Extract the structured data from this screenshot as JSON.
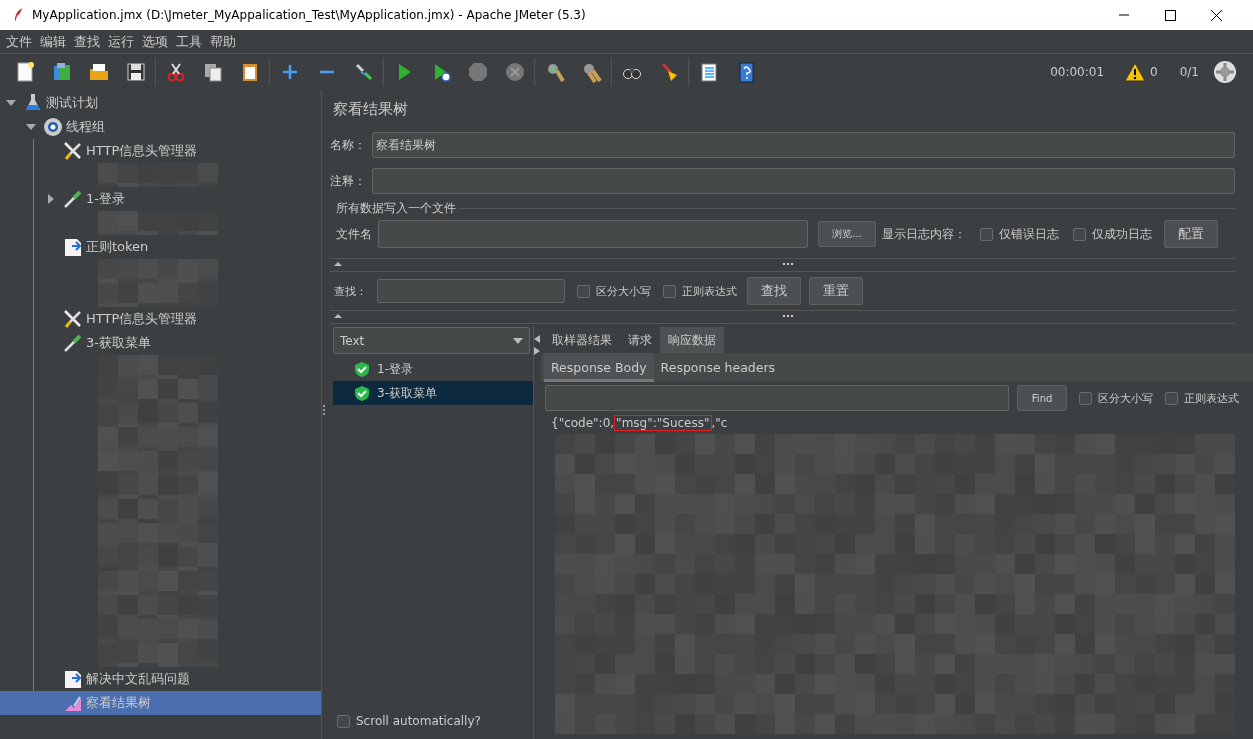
{
  "window": {
    "title": "MyApplication.jmx (D:\\Jmeter_MyAppalication_Test\\MyApplication.jmx) - Apache JMeter (5.3)"
  },
  "menu": [
    "文件",
    "编辑",
    "查找",
    "运行",
    "选项",
    "工具",
    "帮助"
  ],
  "toolbar": {
    "timer": "00:00:01",
    "warnings": "0",
    "threads": "0/1"
  },
  "tree": [
    {
      "label": "测试计划",
      "kind": "plan",
      "expanded": true,
      "selected": false,
      "children": [
        {
          "label": "线程组",
          "kind": "thread-group",
          "expanded": true,
          "selected": false,
          "children": [
            {
              "label": "HTTP信息头管理器",
              "kind": "config",
              "selected": false
            },
            {
              "kind": "blurred"
            },
            {
              "label": "1-登录",
              "kind": "sampler",
              "expanded": false,
              "selected": false
            },
            {
              "kind": "blurred"
            },
            {
              "label": "正则token",
              "kind": "processor",
              "selected": false
            },
            {
              "kind": "blurred"
            },
            {
              "kind": "blurred"
            },
            {
              "label": "HTTP信息头管理器",
              "kind": "config",
              "selected": false
            },
            {
              "label": "3-获取菜单",
              "kind": "sampler",
              "selected": false
            },
            {
              "kind": "blurred"
            },
            {
              "kind": "blurred"
            },
            {
              "kind": "blurred"
            },
            {
              "kind": "blurred"
            },
            {
              "kind": "blurred"
            },
            {
              "kind": "blurred"
            },
            {
              "kind": "blurred"
            },
            {
              "kind": "blurred"
            },
            {
              "kind": "blurred"
            },
            {
              "kind": "blurred"
            },
            {
              "kind": "blurred"
            },
            {
              "kind": "blurred"
            },
            {
              "kind": "blurred"
            },
            {
              "label": "解决中文乱码问题",
              "kind": "processor",
              "selected": false
            },
            {
              "label": "察看结果树",
              "kind": "listener",
              "selected": true
            }
          ]
        }
      ]
    }
  ],
  "panel": {
    "title": "察看结果树",
    "name_label": "名称：",
    "name_value": "察看结果树",
    "comment_label": "注释：",
    "file_group": "所有数据写入一个文件",
    "file_label": "文件名",
    "browse": "浏览...",
    "log_label": "显示日志内容：",
    "log_options": [
      {
        "label": "仅错误日志",
        "checked": false
      },
      {
        "label": "仅成功日志",
        "checked": false
      }
    ],
    "config": "配置",
    "search": {
      "label": "查找：",
      "options": [
        {
          "label": "区分大小写",
          "checked": false
        },
        {
          "label": "正则表达式",
          "checked": false
        }
      ],
      "find": "查找",
      "reset": "重置"
    },
    "renderer": "Text",
    "results": [
      {
        "label": "1-登录",
        "selected": false
      },
      {
        "label": "3-获取菜单",
        "selected": true
      }
    ],
    "tabs": [
      {
        "label": "取样器结果",
        "selected": false
      },
      {
        "label": "请求",
        "selected": false
      },
      {
        "label": "响应数据",
        "selected": true
      }
    ],
    "subtabs": [
      {
        "label": "Response Body",
        "selected": true
      },
      {
        "label": "Response headers",
        "selected": false
      }
    ],
    "body_search": {
      "find": "Find",
      "options": [
        {
          "label": "区分大小写",
          "checked": false
        },
        {
          "label": "正则表达式",
          "checked": false
        }
      ]
    },
    "response_body": {
      "before": "{\"code\":0,",
      "highlight": "\"msg\":\"Sucess\"",
      "after": ",\"c"
    },
    "scroll_auto": {
      "label": "Scroll automatically?",
      "checked": false
    }
  }
}
